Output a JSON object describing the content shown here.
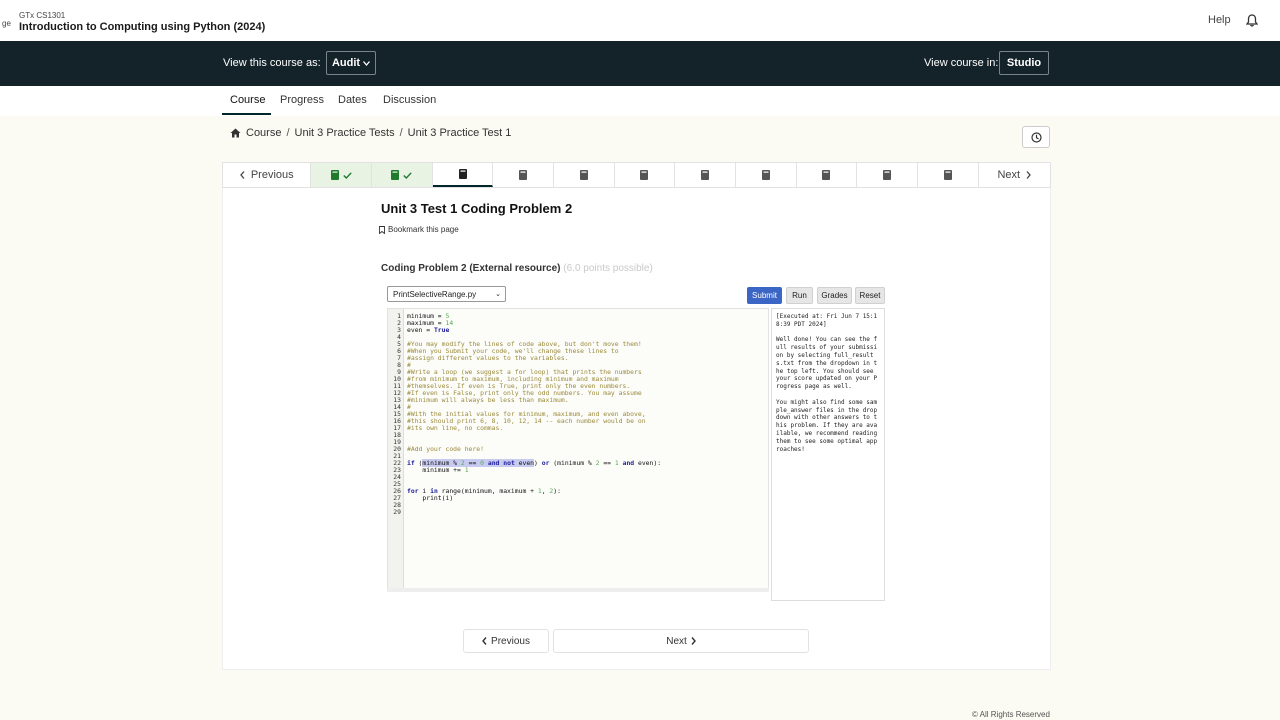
{
  "header": {
    "org": "GTx CS1301",
    "truncated": "ge",
    "course_title": "Introduction to Computing using Python (2024)",
    "help": "Help"
  },
  "master": {
    "view_as_label": "View this course as:",
    "view_as_value": "Audit",
    "view_in_label": "View course in:",
    "view_in_value": "Studio"
  },
  "tabs": [
    {
      "label": "Course"
    },
    {
      "label": "Progress"
    },
    {
      "label": "Dates"
    },
    {
      "label": "Discussion"
    }
  ],
  "breadcrumb": [
    "Course",
    "Unit 3 Practice Tests",
    "Unit 3 Practice Test 1"
  ],
  "sequence": {
    "prev": "Previous",
    "next": "Next"
  },
  "unit": {
    "title": "Unit 3 Test 1 Coding Problem 2",
    "bookmark": "Bookmark this page"
  },
  "problem": {
    "title": "Coding Problem 2 (External resource)",
    "points": "(6.0 points possible)",
    "file": "PrintSelectiveRange.py",
    "submit": "Submit",
    "run": "Run",
    "grades": "Grades",
    "reset": "Reset"
  },
  "output": "[Executed at: Fri Jun 7 15:18:39 PDT 2024]\n\nWell done! You can see the full results of your submission by selecting full_results.txt from the dropdown in the top left. You should see your score updated on your Progress page as well.\n\nYou might also find some sample_answer files in the drop down with other answers to this problem. If they are available, we recommend reading them to see some optimal approaches!",
  "bottom_nav": {
    "prev": "Previous",
    "next": "Next"
  },
  "footer": "© All Rights Reserved"
}
